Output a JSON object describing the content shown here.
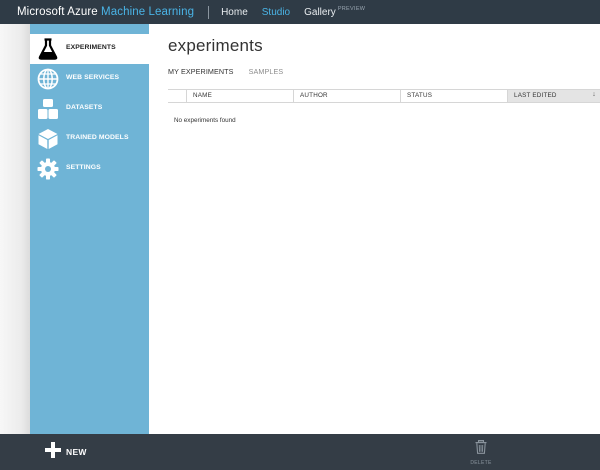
{
  "topbar": {
    "brand_prefix": "Microsoft Azure",
    "brand_accent": "Machine Learning",
    "nav": [
      {
        "label": "Home",
        "active": false
      },
      {
        "label": "Studio",
        "active": true
      },
      {
        "label": "Gallery",
        "superscript": "PREVIEW",
        "active": false
      }
    ]
  },
  "sidebar": {
    "items": [
      {
        "label": "EXPERIMENTS",
        "icon": "flask-icon",
        "active": true
      },
      {
        "label": "WEB SERVICES",
        "icon": "globe-icon",
        "active": false
      },
      {
        "label": "DATASETS",
        "icon": "datasets-icon",
        "active": false
      },
      {
        "label": "TRAINED MODELS",
        "icon": "cube-icon",
        "active": false
      },
      {
        "label": "SETTINGS",
        "icon": "gear-icon",
        "active": false
      }
    ]
  },
  "main": {
    "title": "experiments",
    "tabs": [
      {
        "label": "MY EXPERIMENTS",
        "active": true
      },
      {
        "label": "SAMPLES",
        "active": false
      }
    ],
    "columns": [
      "NAME",
      "AUTHOR",
      "STATUS",
      "LAST EDITED"
    ],
    "sort_indicator": "↓",
    "empty_message": "No experiments found"
  },
  "bottombar": {
    "new_label": "NEW",
    "delete_label": "DELETE"
  },
  "colors": {
    "topbar": "#2f3b46",
    "accent": "#4ab4e6",
    "sidebar": "#6fb4d6",
    "bottombar": "#343d46"
  }
}
